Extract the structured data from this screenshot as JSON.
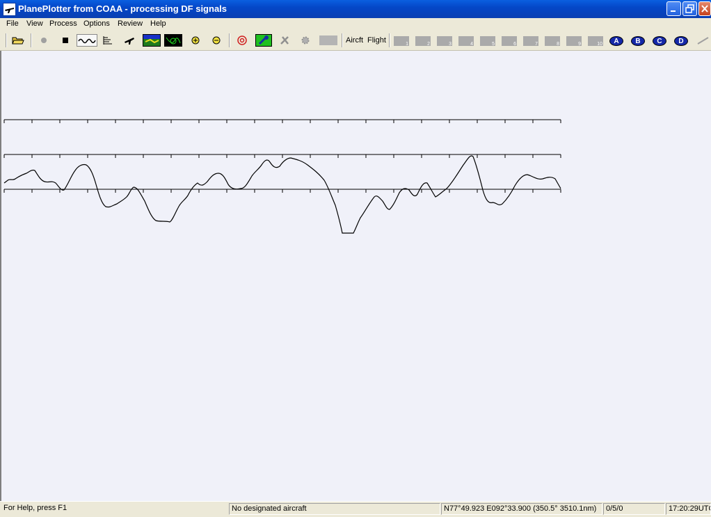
{
  "window": {
    "title": "PlanePlotter from COAA - processing DF signals"
  },
  "menu": {
    "items": [
      "File",
      "View",
      "Process",
      "Options",
      "Review",
      "Help"
    ]
  },
  "toolbar": {
    "text_buttons": [
      "Aircft",
      "Flight"
    ],
    "numbered_tabs": [
      "1",
      "2",
      "3",
      "4",
      "5",
      "6",
      "7",
      "8",
      "9",
      "10"
    ],
    "circle_buttons": [
      "A",
      "B",
      "C",
      "D"
    ],
    "icons": [
      "open-folder-icon",
      "record-icon",
      "stop-icon",
      "waveform-icon",
      "bars-icon",
      "airplane-icon",
      "map-icon",
      "scope-icon",
      "zoom-in-icon",
      "zoom-out-icon",
      "target-icon",
      "wrench-icon",
      "tools-icon",
      "gear-icon",
      "blank-icon",
      "pen-icon"
    ]
  },
  "status": {
    "help": "For Help, press F1",
    "aircraft": "No designated aircraft",
    "position": "N77°49.923 E092°33.900 (350.5° 3510.1nm)",
    "counts": "0/5/0",
    "time": "17:20:29UTC"
  },
  "colors": {
    "workspace_bg": "#f0f1f9",
    "title_bar": "#0a5fe0",
    "trace": "#000000"
  }
}
